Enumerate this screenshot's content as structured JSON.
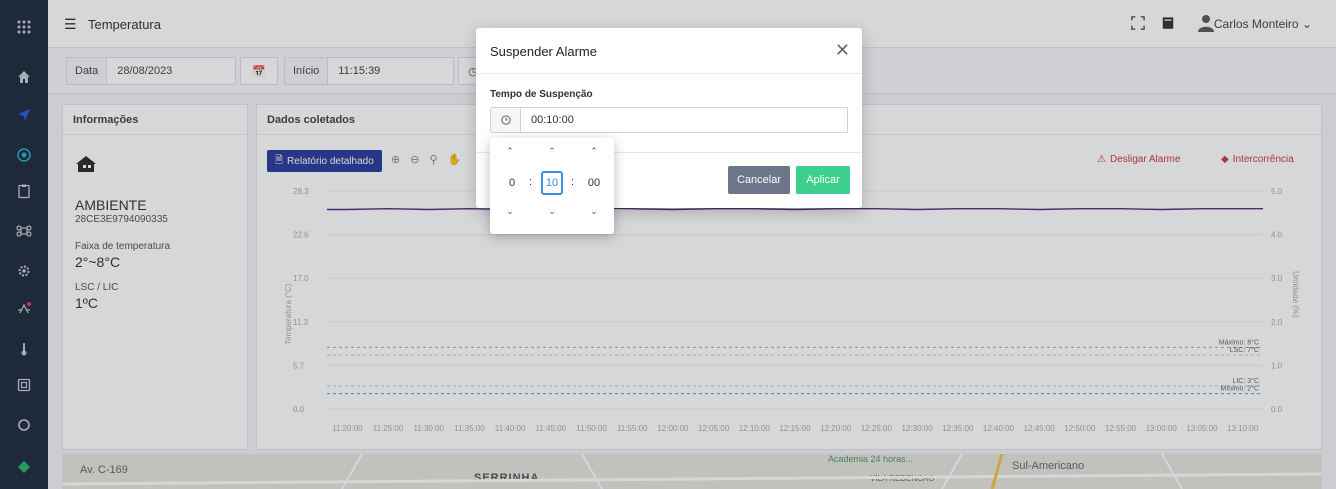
{
  "header": {
    "page_title": "Temperatura",
    "user_name": "Carlos Monteiro"
  },
  "filters": {
    "date_label": "Data",
    "date_value": "28/08/2023",
    "start_label": "Início",
    "start_value": "11:15:39"
  },
  "info_panel": {
    "title": "Informações",
    "ambient_name": "AMBIENTE",
    "serial": "28CE3E9794090335",
    "range_label": "Faixa de temperatura",
    "range_value": "2°~8°C",
    "lsc_lic_label": "LSC / LIC",
    "lsc_lic_value": "1ºC"
  },
  "data_panel": {
    "title": "Dados coletados",
    "report_button": "Relatório detalhado",
    "alarm_off": "Desligar Alarme",
    "intercurrence": "Intercorrência"
  },
  "chart_data": {
    "type": "line",
    "ylabel": "Temperatura (°C)",
    "y2label": "Umidade (%)",
    "y_ticks": [
      "28.3",
      "22.6",
      "17.0",
      "11.3",
      "5.7",
      "0.0"
    ],
    "y2_ticks": [
      "5.0",
      "4.0",
      "3.0",
      "2.0",
      "1.0",
      "0.0"
    ],
    "ylim": [
      0,
      28.3
    ],
    "x": [
      "11:20:00",
      "11:25:00",
      "11:30:00",
      "11:35:00",
      "11:40:00",
      "11:45:00",
      "11:50:00",
      "11:55:00",
      "12:00:00",
      "12:05:00",
      "12:10:00",
      "12:15:00",
      "12:20:00",
      "12:25:00",
      "12:30:00",
      "12:35:00",
      "12:40:00",
      "12:45:00",
      "12:50:00",
      "12:55:00",
      "13:00:00",
      "13:05:00",
      "13:10:00"
    ],
    "series": [
      {
        "values": [
          25.9,
          26.0,
          25.9,
          26.0,
          25.9,
          26.0,
          26.1,
          26.0,
          25.9,
          26.0,
          26.0,
          25.9,
          26.0,
          26.0,
          25.9,
          26.0,
          26.0,
          25.9,
          26.0,
          26.0,
          25.9,
          26.0,
          26.0
        ],
        "color": "#5b2a86"
      }
    ],
    "limit_lines": [
      {
        "label": "Máximo: 8°C",
        "value": 8,
        "color": "#e88b8b"
      },
      {
        "label": "LSC: 7°C",
        "value": 7,
        "color": "#f2b8b8"
      },
      {
        "label": "LIC: 3°C",
        "value": 3,
        "color": "#a9c6ee"
      },
      {
        "label": "Mínimo: 2°C",
        "value": 2,
        "color": "#5a90d8"
      }
    ]
  },
  "map": {
    "labels": [
      "Av. C-169",
      "SERRINHA",
      "VILA REDENCAO",
      "Sul-Americano",
      "Academia 24 horas..."
    ]
  },
  "modal": {
    "title": "Suspender Alarme",
    "field_label": "Tempo de Suspenção",
    "field_value": "00:10:00",
    "cancel": "Cancelar",
    "apply": "Aplicar"
  },
  "time_picker": {
    "hours": "0",
    "minutes": "10",
    "seconds": "00",
    "separator": ":"
  },
  "colors": {
    "sidebar": "#1f2d3d",
    "primary": "#2a3b9c",
    "apply": "#3dcf8e",
    "cancel": "#6d7689",
    "alarm": "#d13a3a"
  }
}
